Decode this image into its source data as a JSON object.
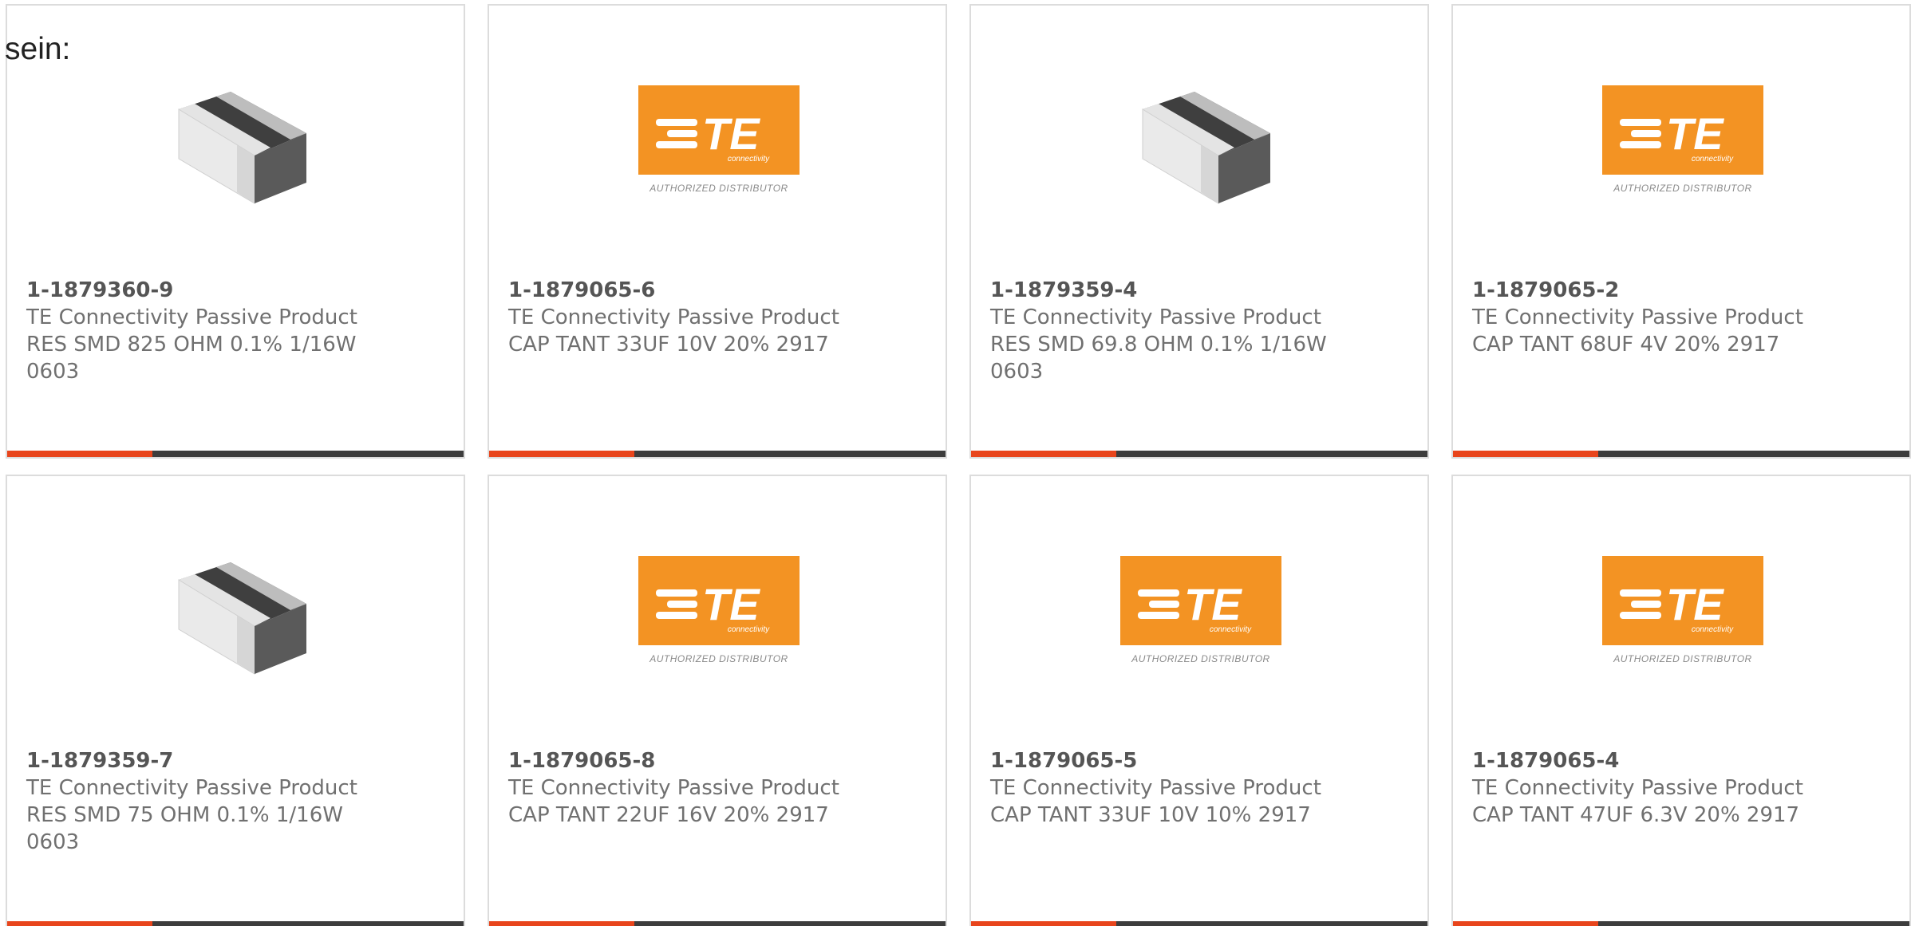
{
  "intro_text": "sein:",
  "colors": {
    "accent_bar": "#e8451c",
    "dark_bar": "#3d3d3d",
    "te_orange": "#f39323"
  },
  "te_logo": {
    "wordmark": "TE",
    "sub": "connectivity",
    "caption": "AUTHORIZED DISTRIBUTOR"
  },
  "products": [
    {
      "image": "smd-chip-resistor",
      "part_number": "1-1879360-9",
      "category": "TE Connectivity Passive Product",
      "desc_line1": "RES SMD 825 OHM 0.1% 1/16W",
      "desc_line2": "0603"
    },
    {
      "image": "te-authorized-distributor-logo",
      "part_number": "1-1879065-6",
      "category": "TE Connectivity Passive Product",
      "desc_line1": "CAP TANT 33UF 10V 20% 2917",
      "desc_line2": ""
    },
    {
      "image": "smd-chip-resistor",
      "part_number": "1-1879359-4",
      "category": "TE Connectivity Passive Product",
      "desc_line1": "RES SMD 69.8 OHM 0.1% 1/16W",
      "desc_line2": "0603"
    },
    {
      "image": "te-authorized-distributor-logo",
      "part_number": "1-1879065-2",
      "category": "TE Connectivity Passive Product",
      "desc_line1": "CAP TANT 68UF 4V 20% 2917",
      "desc_line2": ""
    },
    {
      "image": "smd-chip-resistor",
      "part_number": "1-1879359-7",
      "category": "TE Connectivity Passive Product",
      "desc_line1": "RES SMD 75 OHM 0.1% 1/16W",
      "desc_line2": "0603"
    },
    {
      "image": "te-authorized-distributor-logo",
      "part_number": "1-1879065-8",
      "category": "TE Connectivity Passive Product",
      "desc_line1": "CAP TANT 22UF 16V 20% 2917",
      "desc_line2": ""
    },
    {
      "image": "te-authorized-distributor-logo",
      "part_number": "1-1879065-5",
      "category": "TE Connectivity Passive Product",
      "desc_line1": "CAP TANT 33UF 10V 10% 2917",
      "desc_line2": ""
    },
    {
      "image": "te-authorized-distributor-logo",
      "part_number": "1-1879065-4",
      "category": "TE Connectivity Passive Product",
      "desc_line1": "CAP TANT 47UF 6.3V 20% 2917",
      "desc_line2": ""
    }
  ]
}
